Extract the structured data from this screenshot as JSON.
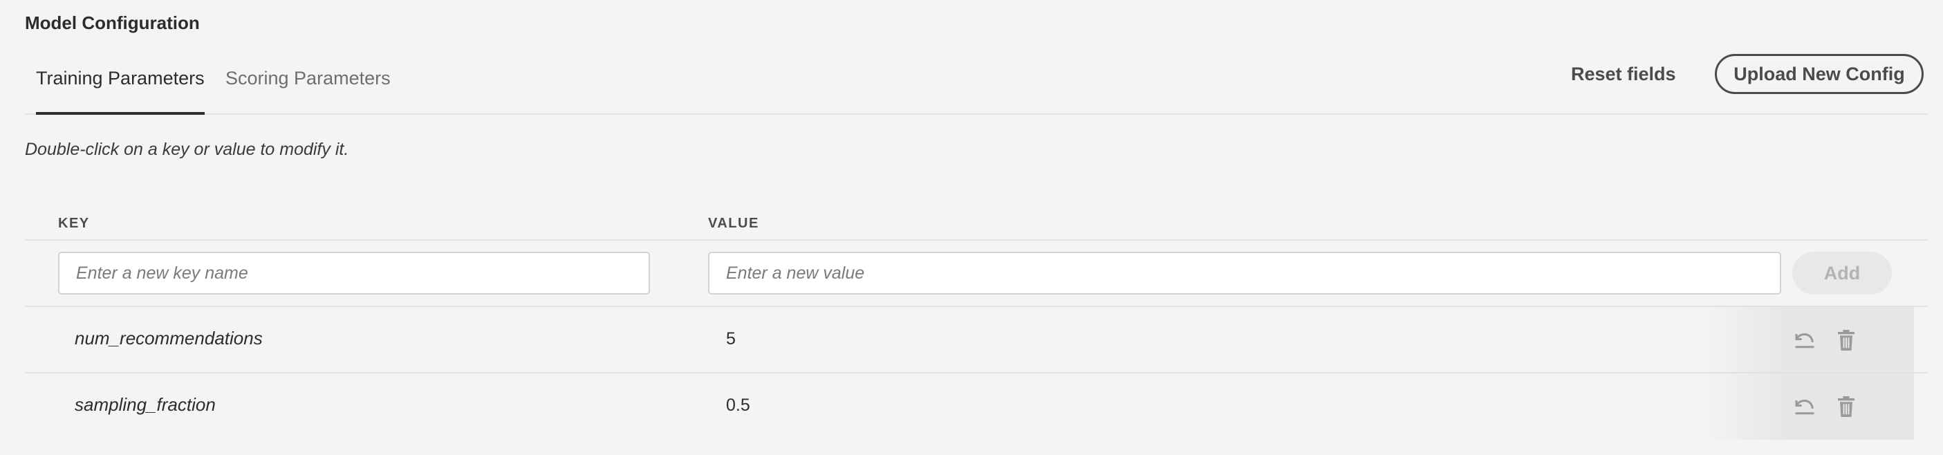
{
  "header": {
    "title": "Model Configuration"
  },
  "tabs": [
    {
      "label": "Training Parameters",
      "active": true
    },
    {
      "label": "Scoring Parameters",
      "active": false
    }
  ],
  "actions": {
    "reset_label": "Reset fields",
    "upload_label": "Upload New Config"
  },
  "hint": "Double-click on a key or value to modify it.",
  "table": {
    "columns": {
      "key": "KEY",
      "value": "VALUE"
    },
    "new_entry": {
      "key_placeholder": "Enter a new key name",
      "value_placeholder": "Enter a new value",
      "add_label": "Add"
    },
    "rows": [
      {
        "key": "num_recommendations",
        "value": "5",
        "icons": [
          "undo-icon",
          "trash-icon"
        ]
      },
      {
        "key": "sampling_fraction",
        "value": "0.5",
        "icons": [
          "undo-icon",
          "trash-icon"
        ]
      }
    ]
  },
  "colors": {
    "background": "#f4f4f4",
    "text": "#2c2c2c",
    "muted": "#6e6e6e",
    "divider": "#e1e1e1",
    "icon": "#9a9a9a",
    "add_disabled_bg": "#e8e8e8",
    "add_disabled_text": "#b3b3b3"
  }
}
